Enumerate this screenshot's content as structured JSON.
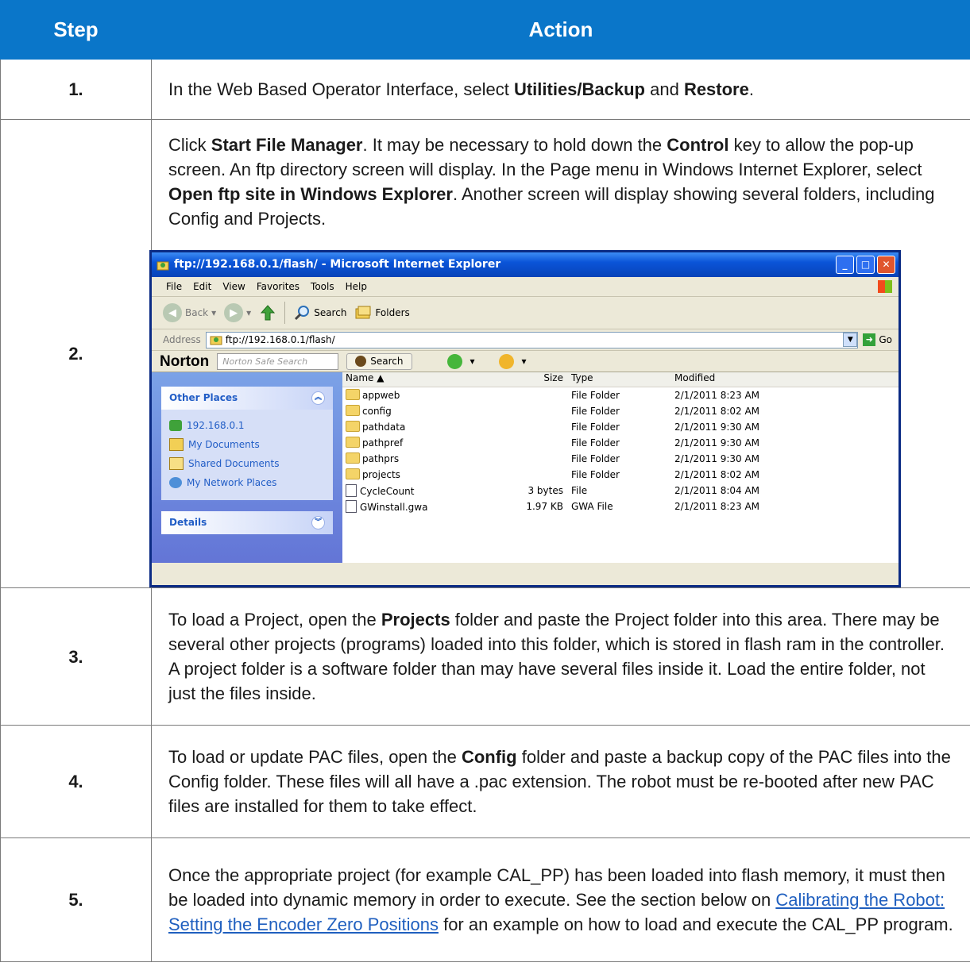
{
  "header": {
    "step": "Step",
    "action": "Action"
  },
  "rows": [
    {
      "num": "1.",
      "text": [
        {
          "t": "In the Web Based Operator Interface, select "
        },
        {
          "t": "Utilities/Backup",
          "b": true
        },
        {
          "t": " and "
        },
        {
          "t": "Restore",
          "b": true
        },
        {
          "t": "."
        }
      ]
    },
    {
      "num": "2.",
      "text": [
        {
          "t": "Click "
        },
        {
          "t": "Start File Manager",
          "b": true
        },
        {
          "t": ". It may be necessary to hold down the "
        },
        {
          "t": "Control",
          "b": true
        },
        {
          "t": " key to allow the pop-up screen. An ftp directory screen will display. In the Page menu in Windows Internet Explorer, select "
        },
        {
          "t": "Open ftp site in Windows Explorer",
          "b": true
        },
        {
          "t": ". Another screen will display showing several folders, including Config and Projects."
        }
      ]
    },
    {
      "num": "3.",
      "text": [
        {
          "t": "To load a Project, open the "
        },
        {
          "t": "Projects",
          "b": true
        },
        {
          "t": " folder and paste the Project folder into this area. There may be several other projects (programs) loaded into this folder, which is stored in flash ram in the controller. A project folder is a software folder than may have several files inside it. Load the entire folder, not just the files inside."
        }
      ]
    },
    {
      "num": "4.",
      "text": [
        {
          "t": "To load or update PAC files, open the "
        },
        {
          "t": "Config",
          "b": true
        },
        {
          "t": " folder and paste a backup copy of the PAC files into the Config folder. These files will all have a .pac extension. The robot must be re-booted after new PAC files are installed for them to take effect."
        }
      ]
    },
    {
      "num": "5.",
      "text": [
        {
          "t": "Once the appropriate project (for example CAL_PP) has been loaded into flash memory, it must then be loaded into dynamic memory in order to execute. See the section below on "
        },
        {
          "t": "Calibrating the Robot: Setting the Encoder Zero Positions",
          "link": true
        },
        {
          "t": " for an example on how to load and execute the CAL_PP program."
        }
      ]
    }
  ],
  "explorer": {
    "title": "ftp://192.168.0.1/flash/ - Microsoft Internet Explorer",
    "menu": [
      "File",
      "Edit",
      "View",
      "Favorites",
      "Tools",
      "Help"
    ],
    "toolbar": {
      "back": "Back",
      "search": "Search",
      "folders": "Folders"
    },
    "address_label": "Address",
    "address": "ftp://192.168.0.1/flash/",
    "go": "Go",
    "norton": {
      "logo": "Norton",
      "placeholder": "Norton Safe Search",
      "search": "Search"
    },
    "other_places": {
      "title": "Other Places",
      "items": [
        "192.168.0.1",
        "My Documents",
        "Shared Documents",
        "My Network Places"
      ]
    },
    "details_title": "Details",
    "columns": [
      "Name",
      "Size",
      "Type",
      "Modified"
    ],
    "files": [
      {
        "name": "appweb",
        "size": "",
        "type": "File Folder",
        "modified": "2/1/2011 8:23 AM",
        "folder": true
      },
      {
        "name": "config",
        "size": "",
        "type": "File Folder",
        "modified": "2/1/2011 8:02 AM",
        "folder": true
      },
      {
        "name": "pathdata",
        "size": "",
        "type": "File Folder",
        "modified": "2/1/2011 9:30 AM",
        "folder": true
      },
      {
        "name": "pathpref",
        "size": "",
        "type": "File Folder",
        "modified": "2/1/2011 9:30 AM",
        "folder": true
      },
      {
        "name": "pathprs",
        "size": "",
        "type": "File Folder",
        "modified": "2/1/2011 9:30 AM",
        "folder": true
      },
      {
        "name": "projects",
        "size": "",
        "type": "File Folder",
        "modified": "2/1/2011 8:02 AM",
        "folder": true
      },
      {
        "name": "CycleCount",
        "size": "3 bytes",
        "type": "File",
        "modified": "2/1/2011 8:04 AM",
        "folder": false
      },
      {
        "name": "GWinstall.gwa",
        "size": "1.97 KB",
        "type": "GWA File",
        "modified": "2/1/2011 8:23 AM",
        "folder": false
      }
    ]
  }
}
